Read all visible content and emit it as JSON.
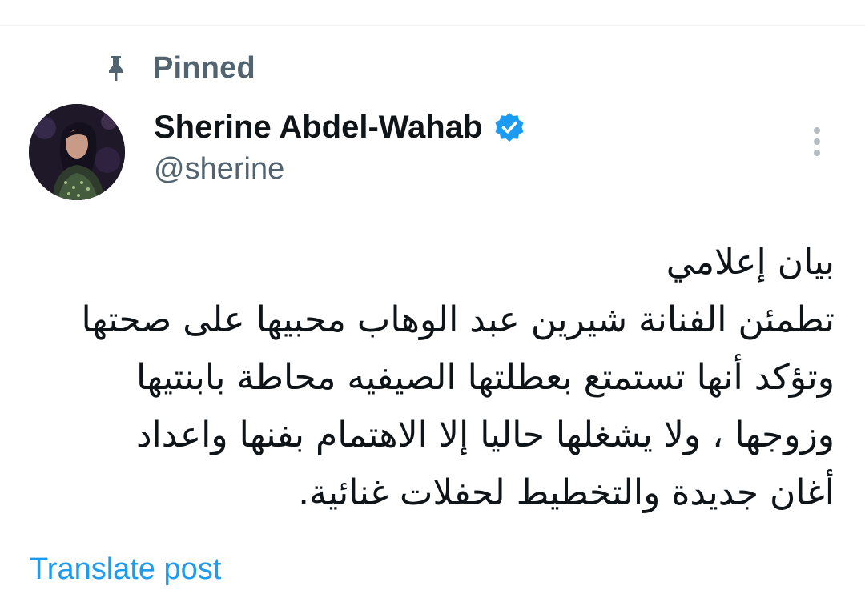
{
  "pinned": {
    "label": "Pinned",
    "icon": "pin-icon"
  },
  "author": {
    "display_name": "Sherine Abdel-Wahab",
    "handle": "@sherine",
    "verified": true,
    "verified_icon": "verified-badge-icon",
    "avatar": "avatar"
  },
  "menu": {
    "icon": "more-vertical-icon"
  },
  "post": {
    "lines": [
      "بيان إعلامي",
      "تطمئن الفنانة شيرين عبد الوهاب محبيها على صحتها",
      "وتؤكد أنها تستمتع بعطلتها الصيفيه محاطة بابنتيها",
      "وزوجها ، ولا يشغلها حاليا إلا الاهتمام بفنها واعداد",
      "أغان جديدة والتخطيط لحفلات غنائية."
    ]
  },
  "translate": {
    "label": "Translate post"
  },
  "colors": {
    "text_primary": "#0f1419",
    "text_secondary": "#536471",
    "accent": "#1d9bf0",
    "divider": "#eff3f4"
  }
}
